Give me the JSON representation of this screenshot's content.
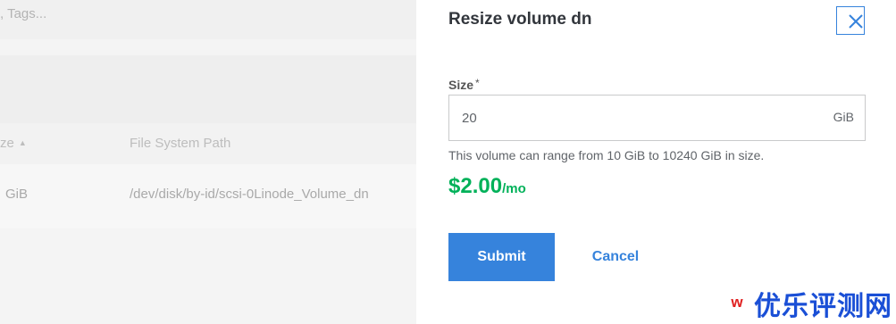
{
  "background": {
    "search_placeholder": ", Tags...",
    "table": {
      "columns": [
        "ze",
        "File System Path"
      ],
      "rows": [
        [
          "GiB",
          "/dev/disk/by-id/scsi-0Linode_Volume_dn"
        ]
      ]
    }
  },
  "drawer": {
    "title": "Resize volume dn",
    "size_label": "Size",
    "required_marker": "*",
    "size_value": "20",
    "size_unit": "GiB",
    "helper_text": "This volume can range from 10 GiB to 10240 GiB in size.",
    "price_amount": "$2.00",
    "price_period": "/mo",
    "submit_label": "Submit",
    "cancel_label": "Cancel"
  },
  "watermark": {
    "badge": "w",
    "text": "优乐评测网"
  },
  "colors": {
    "accent": "#3683dc",
    "price": "#00b159",
    "watermark": "#1a4fd6"
  },
  "icons": {
    "close": "close-icon",
    "sort": "sort-icon"
  }
}
